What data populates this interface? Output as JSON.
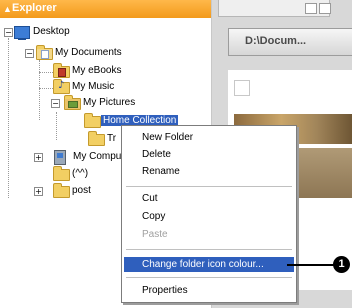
{
  "explorer": {
    "title": "Explorer",
    "tree": {
      "desktop": "Desktop",
      "my_documents": "My Documents",
      "my_ebooks": "My eBooks",
      "my_music": "My Music",
      "my_pictures": "My Pictures",
      "home_collection": "Home Collection",
      "travel": "Tr",
      "my_computer": "My Compu",
      "smiley": "(^^)",
      "post": "post"
    }
  },
  "right_pane": {
    "path": "D:\\Docum..."
  },
  "context_menu": {
    "items": [
      {
        "label": "New Folder",
        "state": "normal"
      },
      {
        "label": "Delete",
        "state": "normal"
      },
      {
        "label": "Rename",
        "state": "normal"
      },
      {
        "label": "Cut",
        "state": "normal"
      },
      {
        "label": "Copy",
        "state": "normal"
      },
      {
        "label": "Paste",
        "state": "disabled"
      },
      {
        "label": "Change folder icon colour...",
        "state": "highlighted"
      },
      {
        "label": "Properties",
        "state": "normal"
      }
    ]
  },
  "callout": {
    "number": "1"
  },
  "colors": {
    "title_bar": "#f39a1b",
    "selection": "#2f5fbd",
    "menu_border": "#7c7c7c"
  }
}
